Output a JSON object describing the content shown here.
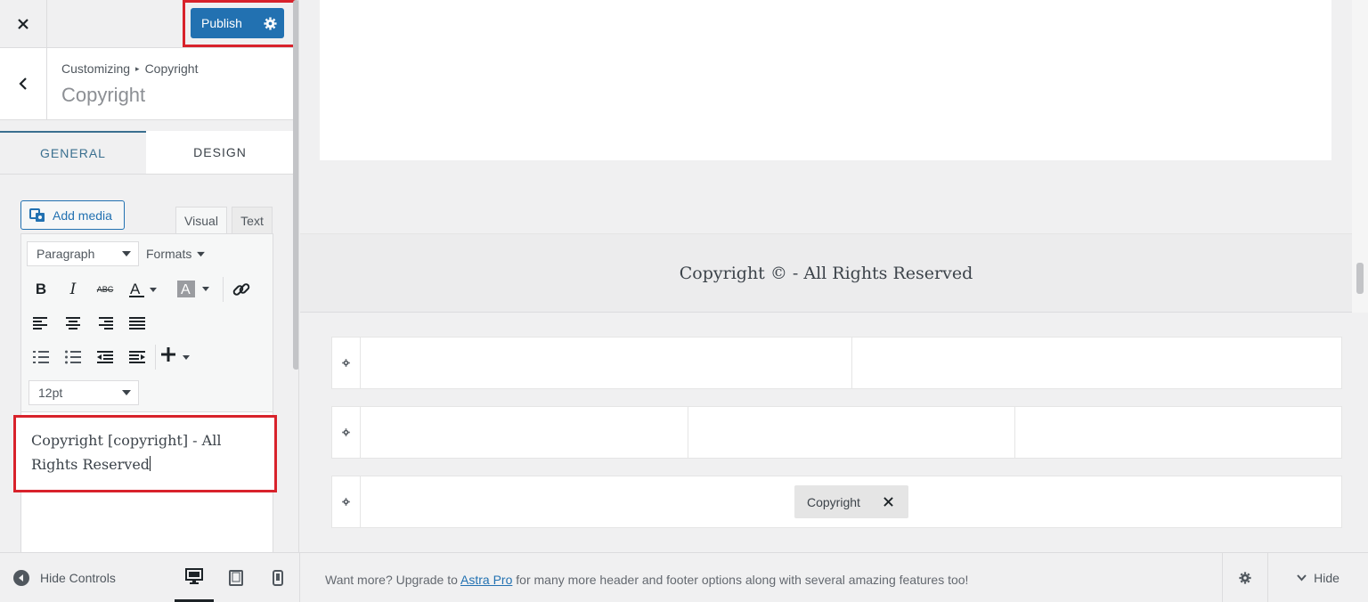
{
  "header": {
    "close_icon": "close-icon",
    "publish_label": "Publish",
    "publish_settings_icon": "gear-icon",
    "accent_color": "#2271b1",
    "highlight_color": "#d8222b"
  },
  "section": {
    "breadcrumb_parent": "Customizing",
    "breadcrumb_current": "Copyright",
    "title": "Copyright"
  },
  "tabs": {
    "general": "GENERAL",
    "design": "DESIGN",
    "active": "GENERAL"
  },
  "editor": {
    "add_media_label": "Add media",
    "mode_visual": "Visual",
    "mode_text": "Text",
    "active_mode": "Visual",
    "block_format": "Paragraph",
    "formats_label": "Formats",
    "font_size": "12pt",
    "content": "Copyright [copyright]  - All Rights Reserved",
    "toolbar_icons": [
      "bold-icon",
      "italic-icon",
      "strikethrough-icon",
      "text-color-icon",
      "background-color-icon",
      "link-icon",
      "align-left-icon",
      "align-center-icon",
      "align-right-icon",
      "align-justify-icon",
      "ordered-list-icon",
      "unordered-list-icon",
      "outdent-icon",
      "indent-icon",
      "insert-plus-icon"
    ]
  },
  "preview": {
    "footer_text": "Copyright ©  - All Rights Reserved",
    "builder_rows": [
      {
        "columns": 2
      },
      {
        "columns": 3
      },
      {
        "columns": 1,
        "element_label": "Copyright"
      }
    ]
  },
  "bottom": {
    "hide_controls_label": "Hide Controls",
    "devices": [
      "desktop",
      "tablet",
      "mobile"
    ],
    "active_device": "desktop",
    "upsell_before": "Want more? Upgrade to ",
    "upsell_link": "Astra Pro",
    "upsell_after": " for many more header and footer options along with several amazing features too!",
    "hide_label": "Hide"
  }
}
